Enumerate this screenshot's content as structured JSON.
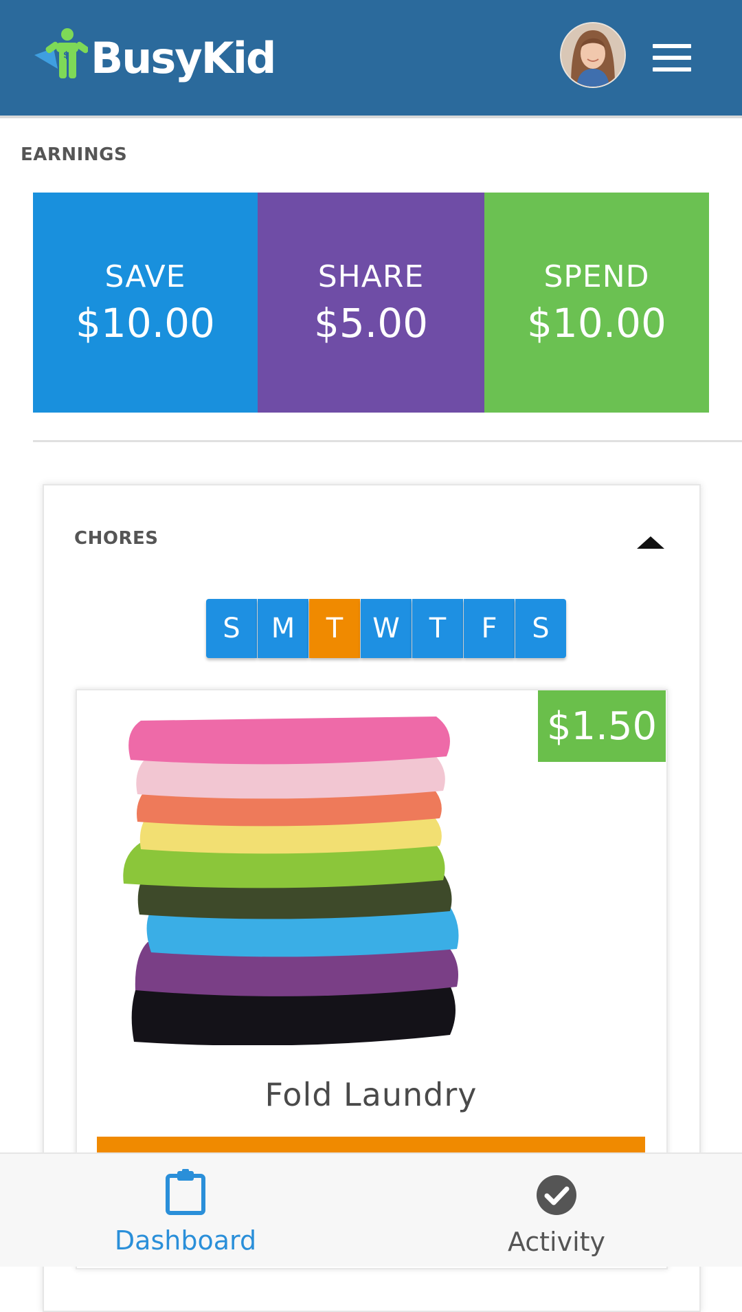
{
  "header": {
    "brand": "BusyKid",
    "avatar_icon": "user-avatar",
    "menu_icon": "hamburger-menu-icon"
  },
  "earnings": {
    "section_label": "EARNINGS",
    "tiles": [
      {
        "label": "SAVE",
        "amount": "$10.00",
        "color": "#1990dd"
      },
      {
        "label": "SHARE",
        "amount": "$5.00",
        "color": "#6f4da6"
      },
      {
        "label": "SPEND",
        "amount": "$10.00",
        "color": "#6bc152"
      }
    ]
  },
  "chores": {
    "section_label": "CHORES",
    "collapse_icon": "caret-up-icon",
    "days": [
      "S",
      "M",
      "T",
      "W",
      "T",
      "F",
      "S"
    ],
    "active_day_index": 2,
    "colors": {
      "day": "#1e90e2",
      "active_day": "#f08a00"
    },
    "items": [
      {
        "title": "Fold Laundry",
        "price": "$1.50",
        "image_icon": "laundry-stack-image",
        "price_color": "#6abf4b",
        "button_color": "#f08a00"
      }
    ]
  },
  "bottom_nav": {
    "items": [
      {
        "label": "Dashboard",
        "icon": "clipboard-icon",
        "active": true,
        "color": "#2a8fd9"
      },
      {
        "label": "Activity",
        "icon": "check-circle-icon",
        "active": false,
        "color": "#555555"
      }
    ]
  }
}
